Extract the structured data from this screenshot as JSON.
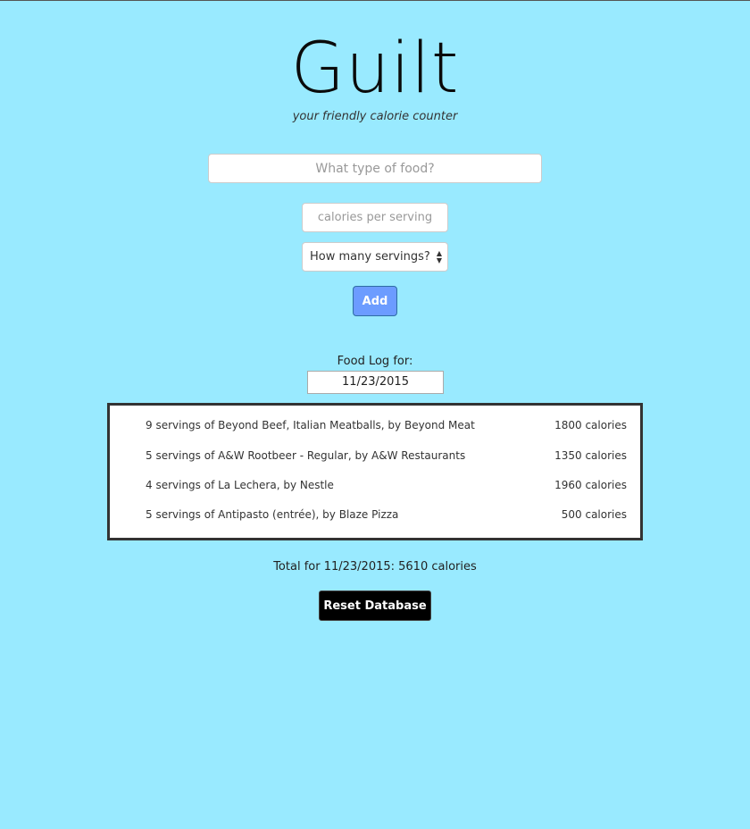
{
  "header": {
    "title": "Guilt",
    "subtitle": "your friendly calorie counter"
  },
  "form": {
    "food_placeholder": "What type of food?",
    "food_value": "",
    "calories_placeholder": "calories per serving",
    "calories_value": "",
    "servings_selected": "How many servings?",
    "add_label": "Add"
  },
  "log": {
    "label": "Food Log for:",
    "date": "11/23/2015",
    "entries": [
      {
        "description": "9 servings of Beyond Beef, Italian Meatballs, by Beyond Meat",
        "calories": "1800 calories"
      },
      {
        "description": "5 servings of A&W Rootbeer - Regular, by A&W Restaurants",
        "calories": "1350 calories"
      },
      {
        "description": "4 servings of La Lechera, by Nestle",
        "calories": "1960 calories"
      },
      {
        "description": "5 servings of Antipasto (entrée), by Blaze Pizza",
        "calories": "500 calories"
      }
    ],
    "total": "Total for 11/23/2015: 5610 calories"
  },
  "footer": {
    "reset_label": "Reset Database"
  },
  "colors": {
    "background": "#99eaff",
    "add_button": "#6c9cff",
    "reset_button": "#000000"
  }
}
